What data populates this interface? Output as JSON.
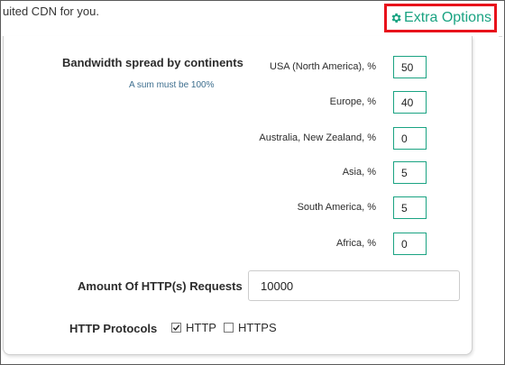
{
  "intro_text": "uited CDN for you.",
  "extra_options": {
    "label": "Extra Options",
    "icon": "gear-icon",
    "color": "#1aa382",
    "highlight": "#e8121b"
  },
  "bandwidth": {
    "title": "Bandwidth spread by continents",
    "hint": "A sum must be 100%",
    "rows": [
      {
        "label": "USA (North America), %",
        "value": "50"
      },
      {
        "label": "Europe, %",
        "value": "40"
      },
      {
        "label": "Australia, New Zealand, %",
        "value": "0"
      },
      {
        "label": "Asia, %",
        "value": "5"
      },
      {
        "label": "South America, %",
        "value": "5"
      },
      {
        "label": "Africa, %",
        "value": "0"
      }
    ]
  },
  "requests": {
    "label": "Amount Of HTTP(s) Requests",
    "value": "10000"
  },
  "protocols": {
    "label": "HTTP Protocols",
    "options": [
      {
        "label": "HTTP",
        "checked": true
      },
      {
        "label": "HTTPS",
        "checked": false
      }
    ]
  }
}
